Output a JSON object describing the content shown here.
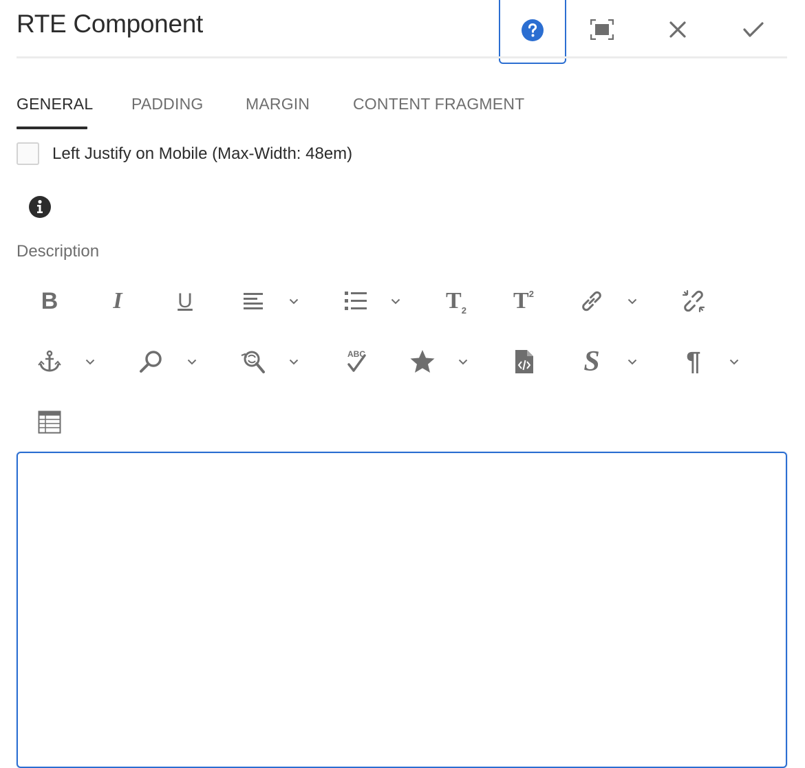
{
  "dialog": {
    "title": "RTE Component"
  },
  "header_actions": {
    "help": "help-icon",
    "fullscreen": "fullscreen-icon",
    "close": "close-icon",
    "done": "checkmark-icon"
  },
  "tabs": [
    {
      "label": "GENERAL",
      "active": true
    },
    {
      "label": "PADDING",
      "active": false
    },
    {
      "label": "MARGIN",
      "active": false
    },
    {
      "label": "CONTENT FRAGMENT",
      "active": false
    }
  ],
  "general": {
    "left_justify_label": "Left Justify on Mobile (Max-Width: 48em)",
    "left_justify_checked": false,
    "description_label": "Description"
  },
  "toolbar": {
    "row1": [
      "bold-icon",
      "italic-icon",
      "underline-icon",
      "align-icon",
      "list-icon",
      "subscript-icon",
      "superscript-icon",
      "link-icon",
      "unlink-icon"
    ],
    "row2": [
      "anchor-icon",
      "find-icon",
      "find-replace-icon",
      "spellcheck-icon",
      "styles-icon",
      "source-edit-icon",
      "strikethrough-icon",
      "paragraph-format-icon"
    ],
    "row3": [
      "table-icon"
    ],
    "bold_glyph": "B",
    "italic_glyph": "I",
    "underline_glyph": "U",
    "sub_glyph": "T",
    "sub_index": "2",
    "sup_glyph": "T",
    "sup_index": "2",
    "spellcheck_glyph": "ABC",
    "strike_glyph": "S",
    "paragraph_glyph": "¶"
  },
  "editor": {
    "content": ""
  },
  "colors": {
    "accent": "#2b6ed1",
    "icon": "#6e6e6e"
  }
}
